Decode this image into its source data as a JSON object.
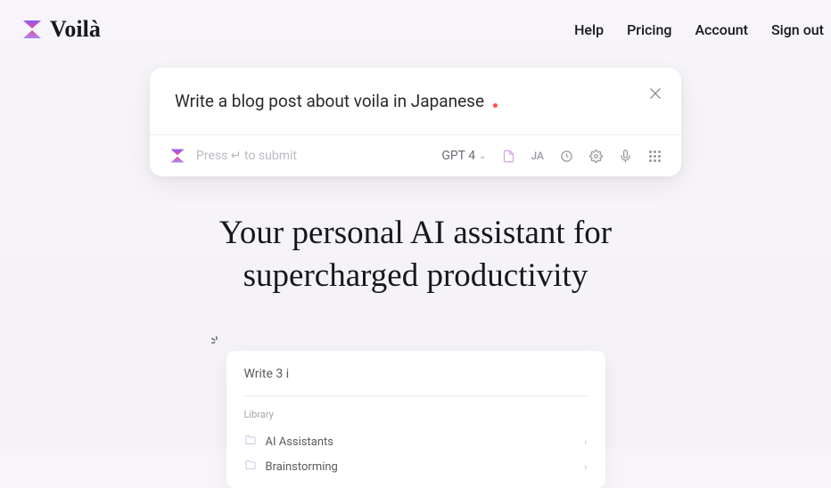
{
  "header": {
    "brand": "Voilà",
    "nav": {
      "help": "Help",
      "pricing": "Pricing",
      "account": "Account",
      "signout": "Sign out"
    }
  },
  "prompt": {
    "text": "Write a blog post about voila in Japanese",
    "submitHint": "Press ↵ to submit",
    "model": "GPT 4",
    "lang": "JA"
  },
  "hero": {
    "line1": "Your personal AI assistant for",
    "line2": "supercharged productivity"
  },
  "secondary": {
    "input": "Write 3 i",
    "libraryLabel": "Library",
    "items": [
      {
        "name": "AI Assistants"
      },
      {
        "name": "Brainstorming"
      }
    ]
  }
}
